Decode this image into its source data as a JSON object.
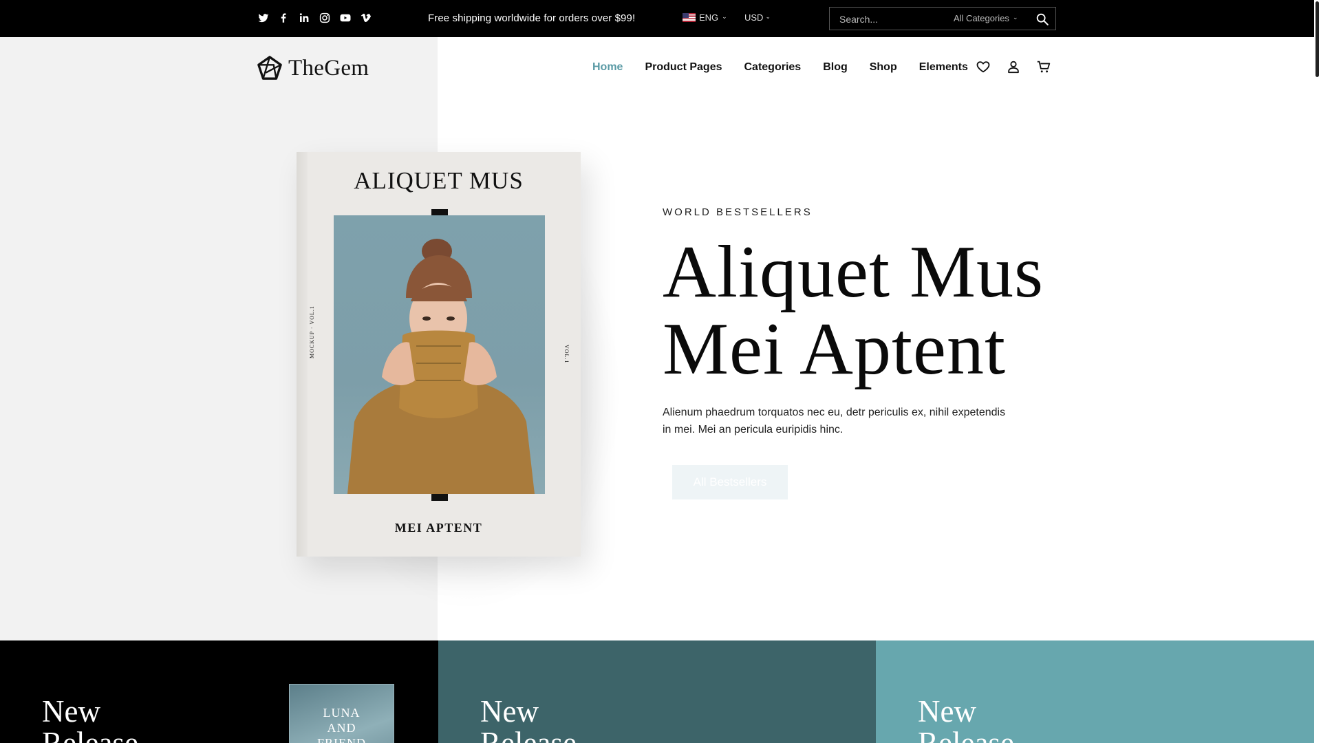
{
  "topbar": {
    "socials": [
      "twitter-icon",
      "facebook-icon",
      "linkedin-icon",
      "instagram-icon",
      "youtube-icon",
      "vimeo-icon"
    ],
    "shipping_text": "Free shipping worldwide for orders over $99!",
    "language": "ENG",
    "currency": "USD",
    "search_placeholder": "Search...",
    "category_select": "All Categories"
  },
  "header": {
    "logo_text": "TheGem",
    "nav": [
      "Home",
      "Product Pages",
      "Categories",
      "Blog",
      "Shop",
      "Elements"
    ],
    "active_nav": "Home",
    "icons": [
      "heart-icon",
      "user-icon",
      "cart-icon"
    ]
  },
  "book": {
    "title": "ALIQUET MUS",
    "subtitle": "MEI APTENT",
    "side_left": "MOCKUP · VOL.1",
    "side_right": "VOL.1"
  },
  "hero": {
    "eyebrow": "WORLD BESTSELLERS",
    "title_line1": "Aliquet Mus",
    "title_line2": "Mei Aptent",
    "description_line1": "Alienum phaedrum torquatos nec eu, detr periculis ex, nihil expetendis",
    "description_line2": "in mei. Mei an pericula euripidis hinc.",
    "button_label": "All Bestsellers"
  },
  "tiles": [
    {
      "title_line1": "New",
      "title_line2": "Release"
    },
    {
      "title_line1": "New",
      "title_line2": "Release"
    },
    {
      "title_line1": "New",
      "title_line2": "Release"
    }
  ],
  "tile_book": {
    "line1": "LUNA",
    "line2": "AND",
    "line3": "FRIEND"
  },
  "colors": {
    "accent": "#5a9aa5",
    "topbar_bg": "#000000",
    "tile_dark": "#000000",
    "tile_teal_dark": "#3d6469",
    "tile_teal_light": "#67a7ae"
  }
}
